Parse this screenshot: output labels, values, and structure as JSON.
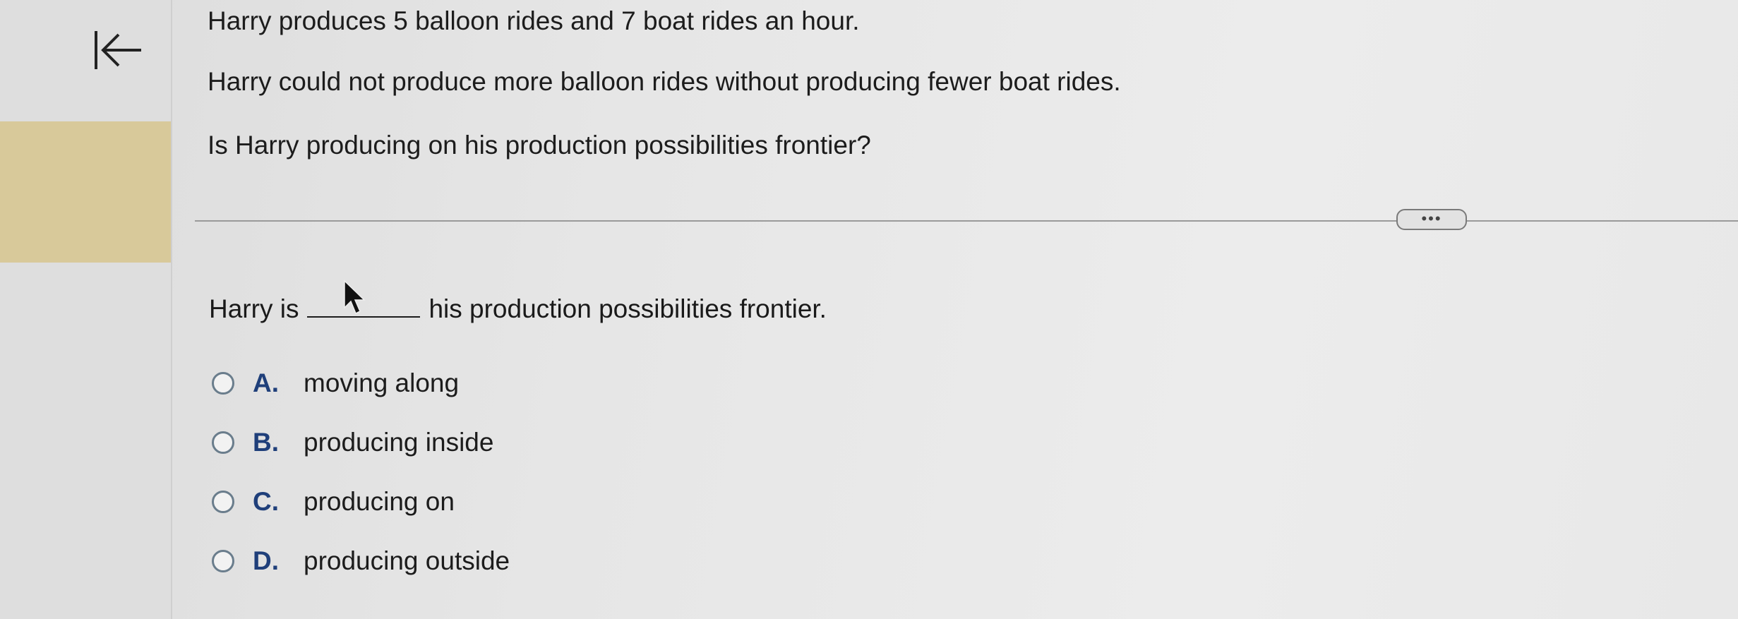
{
  "question": {
    "line1": "Harry produces 5 balloon rides and 7 boat rides an hour.",
    "line2": "Harry could not produce more balloon rides without producing fewer boat rides.",
    "line3": "Is Harry producing on his production possibilities frontier?"
  },
  "divider": {
    "more_label": "•••"
  },
  "prompt": {
    "before": "Harry is",
    "after": "his production possibilities frontier."
  },
  "options": [
    {
      "letter": "A.",
      "text": "moving along"
    },
    {
      "letter": "B.",
      "text": "producing inside"
    },
    {
      "letter": "C.",
      "text": "producing on"
    },
    {
      "letter": "D.",
      "text": "producing outside"
    }
  ],
  "icons": {
    "collapse": "collapse-left-icon",
    "radio": "radio-unchecked-icon",
    "cursor": "mouse-pointer-icon"
  },
  "colors": {
    "option_letter": "#1f3f7a",
    "radio_border": "#6a7d8c",
    "highlight": "#d8c99a"
  }
}
